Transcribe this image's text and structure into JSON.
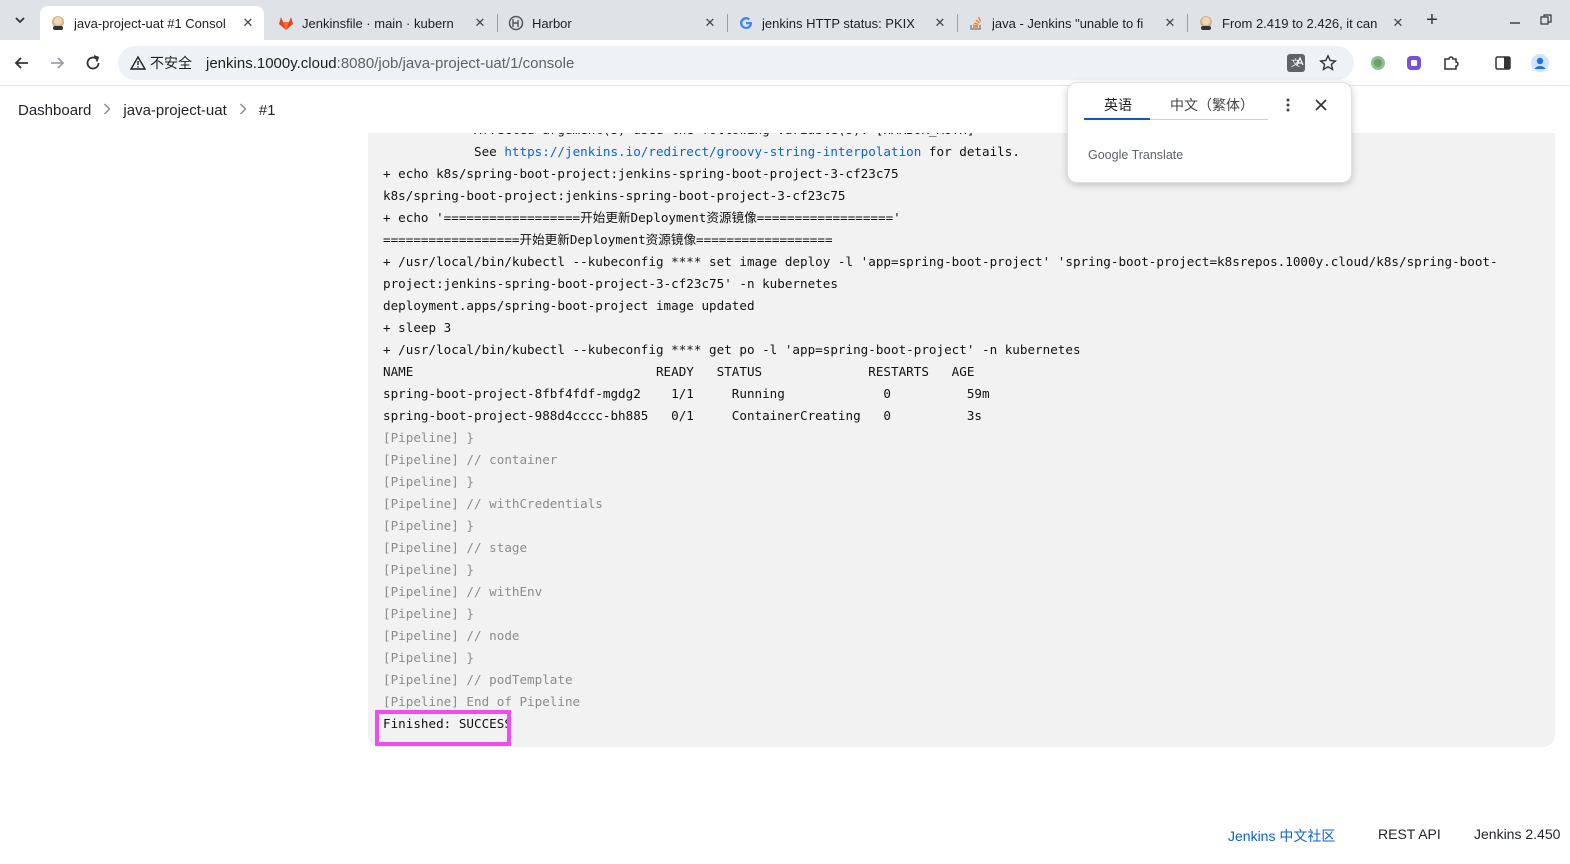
{
  "browser": {
    "tabs": [
      {
        "title": "java-project-uat #1 Consol",
        "active": true
      },
      {
        "title": "Jenkinsfile · main · kubern",
        "active": false
      },
      {
        "title": "Harbor",
        "active": false
      },
      {
        "title": "jenkins HTTP status: PKIX",
        "active": false
      },
      {
        "title": "java - Jenkins \"unable to fi",
        "active": false
      },
      {
        "title": "From 2.419 to 2.426, it can",
        "active": false
      }
    ],
    "security_label": "不安全",
    "url_host": "jenkins.1000y.cloud",
    "url_path": ":8080/job/java-project-uat/1/console"
  },
  "breadcrumb": {
    "items": [
      "Dashboard",
      "java-project-uat",
      "#1"
    ]
  },
  "console": {
    "line0": "            Affected argument(s) used the following variable(s): [HARBOR_AUTH]",
    "see_prefix": "            See ",
    "see_link": "https://jenkins.io/redirect/groovy-string-interpolation",
    "see_suffix": " for details.",
    "line1": "+ echo k8s/spring-boot-project:jenkins-spring-boot-project-3-cf23c75",
    "line2": "k8s/spring-boot-project:jenkins-spring-boot-project-3-cf23c75",
    "line3": "+ echo '==================开始更新Deployment资源镜像=================='",
    "line4": "==================开始更新Deployment资源镜像==================",
    "line5": "+ /usr/local/bin/kubectl --kubeconfig **** set image deploy -l 'app=spring-boot-project' 'spring-boot-project=k8srepos.1000y.cloud/k8s/spring-boot-project:jenkins-spring-boot-project-3-cf23c75' -n kubernetes",
    "line6": "deployment.apps/spring-boot-project image updated",
    "line7": "+ sleep 3",
    "line8": "+ /usr/local/bin/kubectl --kubeconfig **** get po -l 'app=spring-boot-project' -n kubernetes",
    "line9": "NAME                                READY   STATUS              RESTARTS   AGE",
    "line10": "spring-boot-project-8fbf4fdf-mgdg2    1/1     Running             0          59m",
    "line11": "spring-boot-project-988d4cccc-bh885   0/1     ContainerCreating   0          3s",
    "pipeline": [
      "[Pipeline] }",
      "[Pipeline] // container",
      "[Pipeline] }",
      "[Pipeline] // withCredentials",
      "[Pipeline] }",
      "[Pipeline] // stage",
      "[Pipeline] }",
      "[Pipeline] // withEnv",
      "[Pipeline] }",
      "[Pipeline] // node",
      "[Pipeline] }",
      "[Pipeline] // podTemplate",
      "[Pipeline] End of Pipeline"
    ],
    "finished": "Finished: SUCCESS"
  },
  "translate": {
    "lang_source": "英语",
    "lang_target": "中文（繁体）",
    "brand_google": "Google",
    "brand_translate": "Translate"
  },
  "footer": {
    "community": "Jenkins 中文社区",
    "rest_api": "REST API",
    "version": "Jenkins 2.450"
  },
  "colors": {
    "highlight": "#ee4df0",
    "link": "#0b63d3"
  }
}
